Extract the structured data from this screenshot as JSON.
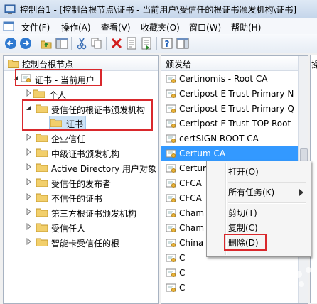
{
  "title_bar": {
    "title": "控制台1 - [控制台根节点\\证书 - 当前用户\\受信任的根证书颁发机构\\证书]"
  },
  "menu": [
    "文件(F)",
    "操作(A)",
    "查看(V)",
    "收藏夹(O)",
    "窗口(W)",
    "帮助(H)"
  ],
  "toolbar": {
    "icons": [
      "back-arrow-icon",
      "forward-arrow-icon",
      "up-folder-icon",
      "show-hide-tree-icon",
      "cut-icon",
      "copy-icon",
      "delete-icon",
      "properties-icon",
      "export-list-icon",
      "help-icon",
      "show-hide-action-pane-icon"
    ]
  },
  "tree": {
    "root": "控制台根节点",
    "store": "证书 - 当前用户",
    "items": [
      {
        "label": "个人",
        "expanded": false
      },
      {
        "label": "受信任的根证书颁发机构",
        "expanded": true
      },
      {
        "label": "证书",
        "child": true
      },
      {
        "label": "企业信任",
        "expanded": false
      },
      {
        "label": "中级证书颁发机构",
        "expanded": false
      },
      {
        "label": "Active Directory 用户对象",
        "expanded": false
      },
      {
        "label": "受信任的发布者",
        "expanded": false
      },
      {
        "label": "不信任的证书",
        "expanded": false
      },
      {
        "label": "第三方根证书颁发机构",
        "expanded": false
      },
      {
        "label": "受信任人",
        "expanded": false
      },
      {
        "label": "智能卡受信任的根",
        "expanded": false
      }
    ]
  },
  "list": {
    "column_header": "颁发给",
    "rows": [
      "Certinomis - Root CA",
      "Certipost E-Trust Primary N",
      "Certipost E-Trust Primary Q",
      "Certipost E-Trust TOP Root",
      "certSIGN ROOT CA",
      "Certum CA",
      "Certum",
      "CFCA",
      "CFCA",
      "Cham",
      "Cham",
      "China",
      "C",
      "C",
      "C"
    ],
    "selected_index": 5
  },
  "action_pane": {
    "header": "操"
  },
  "context_menu": {
    "items": [
      "打开(O)",
      "所有任务(K)",
      "剪切(T)",
      "复制(C)",
      "删除(D)"
    ]
  },
  "colors": {
    "highlight": "#d9282c",
    "selection": "#3399ff"
  }
}
